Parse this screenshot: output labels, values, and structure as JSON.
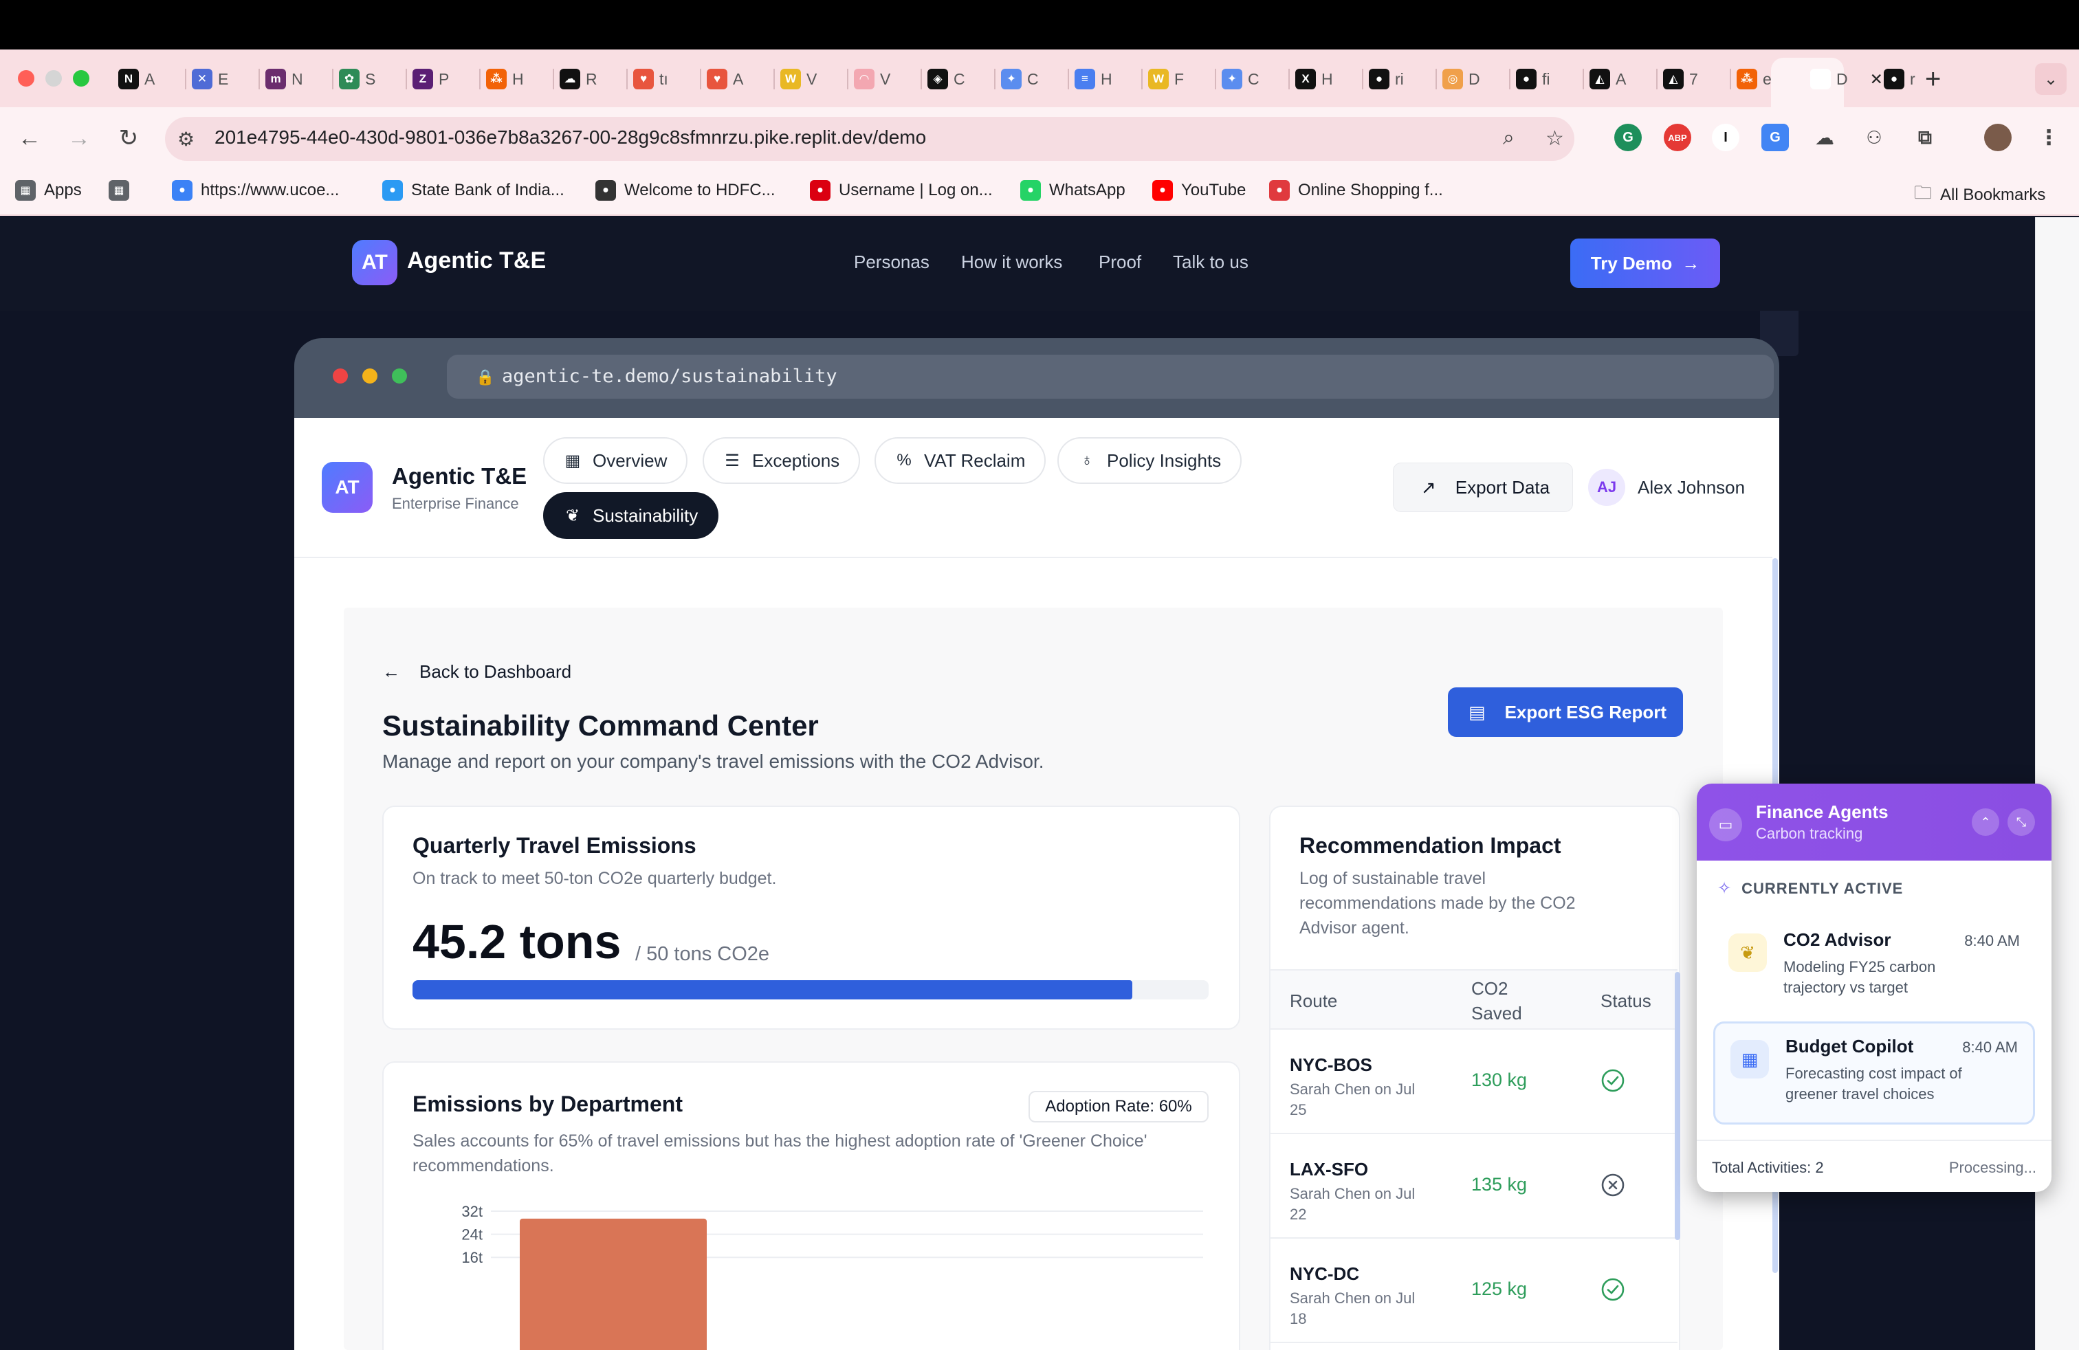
{
  "browser": {
    "tabs": [
      {
        "icon": "notion-icon",
        "label": "A",
        "color": "#111111",
        "glyph": "N"
      },
      {
        "icon": "cross-icon",
        "label": "E",
        "color": "#4f6bd6",
        "glyph": "✕"
      },
      {
        "icon": "m-icon",
        "label": "N",
        "color": "#6b2d6e",
        "glyph": "m"
      },
      {
        "icon": "leaf-icon",
        "label": "S",
        "color": "#2e8b57",
        "glyph": "✿"
      },
      {
        "icon": "z-icon",
        "label": "P",
        "color": "#5b1f74",
        "glyph": "Z"
      },
      {
        "icon": "replit-icon",
        "label": "H",
        "color": "#f26207",
        "glyph": "⁂"
      },
      {
        "icon": "cloud-icon",
        "label": "R",
        "color": "#111111",
        "glyph": "☁"
      },
      {
        "icon": "lovable-icon",
        "label": "tı",
        "color": "#e8553e",
        "glyph": "♥"
      },
      {
        "icon": "lovable-icon",
        "label": "A",
        "color": "#e8553e",
        "glyph": "♥"
      },
      {
        "icon": "w-icon",
        "label": "V",
        "color": "#e9b824",
        "glyph": "W"
      },
      {
        "icon": "rainbow-icon",
        "label": "V",
        "color": "#f3a7b1",
        "glyph": "◠"
      },
      {
        "icon": "cursor-icon",
        "label": "C",
        "color": "#111111",
        "glyph": "◈"
      },
      {
        "icon": "gemini-icon",
        "label": "C",
        "color": "#5b8def",
        "glyph": "✦"
      },
      {
        "icon": "docs-icon",
        "label": "H",
        "color": "#4a7ef0",
        "glyph": "≡"
      },
      {
        "icon": "w-icon",
        "label": "F",
        "color": "#e9b824",
        "glyph": "W"
      },
      {
        "icon": "gemini-icon",
        "label": "C",
        "color": "#5b8def",
        "glyph": "✦"
      },
      {
        "icon": "x-icon",
        "label": "H",
        "color": "#111111",
        "glyph": "X"
      },
      {
        "icon": "github-icon",
        "label": "ri",
        "color": "#111111",
        "glyph": "●"
      },
      {
        "icon": "bolt-icon",
        "label": "D",
        "color": "#f0a04b",
        "glyph": "◎"
      },
      {
        "icon": "github-icon",
        "label": "fi",
        "color": "#111111",
        "glyph": "●"
      },
      {
        "icon": "ai-icon",
        "label": "A",
        "color": "#111111",
        "glyph": "◭"
      },
      {
        "icon": "ai-icon",
        "label": "7",
        "color": "#111111",
        "glyph": "◭"
      },
      {
        "icon": "replit-icon",
        "label": "e",
        "color": "#f26207",
        "glyph": "⁂"
      },
      {
        "icon": "page-icon",
        "label": "D",
        "color": "#ffffff",
        "glyph": ""
      },
      {
        "icon": "github-icon",
        "label": "r",
        "color": "#111111",
        "glyph": "●"
      }
    ],
    "url": "201e4795-44e0-430d-9801-036e7b8a3267-00-28g9c8sfmnrzu.pike.replit.dev/demo",
    "bookmarks": [
      {
        "label": "Apps",
        "icon": "apps-grid-icon",
        "color": "#5f6368"
      },
      {
        "label": "",
        "icon": "tab-groups-icon",
        "color": "#5f6368"
      },
      {
        "label": "https://www.ucoe...",
        "icon": "link-icon",
        "color": "#3b82f6"
      },
      {
        "label": "State Bank of India...",
        "icon": "sbi-icon",
        "color": "#2b9af3"
      },
      {
        "label": "Welcome to HDFC...",
        "icon": "globe-icon",
        "color": "#333333"
      },
      {
        "label": "Username | Log on...",
        "icon": "hsbc-icon",
        "color": "#db0011"
      },
      {
        "label": "WhatsApp",
        "icon": "whatsapp-icon",
        "color": "#25d366"
      },
      {
        "label": "YouTube",
        "icon": "youtube-icon",
        "color": "#ff0000"
      },
      {
        "label": "Online Shopping f...",
        "icon": "shopping-icon",
        "color": "#e03a3e"
      }
    ],
    "all_bookmarks": "All Bookmarks"
  },
  "site": {
    "logo": "AT",
    "brand": "Agentic T&E",
    "nav": [
      "Personas",
      "How it works",
      "Proof",
      "Talk to us"
    ],
    "cta": "Try Demo"
  },
  "mock_browser": {
    "url": "agentic-te.demo/sustainability"
  },
  "app": {
    "logo": "AT",
    "name": "Agentic T&E",
    "subtitle": "Enterprise Finance",
    "tabs": [
      {
        "label": "Overview",
        "icon": "grid-icon",
        "active": false
      },
      {
        "label": "Exceptions",
        "icon": "list-icon",
        "active": false
      },
      {
        "label": "VAT Reclaim",
        "icon": "percent-icon",
        "active": false
      },
      {
        "label": "Policy Insights",
        "icon": "lightbulb-icon",
        "active": false
      },
      {
        "label": "Sustainability",
        "icon": "leaf-icon",
        "active": true
      }
    ],
    "export_data": "Export Data",
    "user_initials": "AJ",
    "user_name": "Alex Johnson"
  },
  "page": {
    "back": "Back to Dashboard",
    "title": "Sustainability Command Center",
    "description": "Manage and report on your company's travel emissions with the CO2 Advisor.",
    "export_esg": "Export ESG Report"
  },
  "emissions": {
    "title": "Quarterly Travel Emissions",
    "description": "On track to meet 50-ton CO2e quarterly budget.",
    "value": "45.2 tons",
    "unit": "/ 50 tons CO2e",
    "progress": 0.904
  },
  "department": {
    "title": "Emissions by Department",
    "badge": "Adoption Rate: 60%",
    "description_line1": "Sales accounts for 65% of travel emissions but has the highest adoption rate of 'Greener Choice'",
    "description_line2": "recommendations."
  },
  "chart_data": {
    "type": "bar",
    "categories": [],
    "values": [
      29.4
    ],
    "bar_color": "#d97556",
    "yticks": [
      "32t",
      "24t",
      "16t"
    ],
    "ylim": [
      0,
      32
    ],
    "grid": true
  },
  "impact": {
    "title": "Recommendation Impact",
    "desc_lines": [
      "Log of sustainable travel",
      "recommendations made by the CO2",
      "Advisor agent."
    ],
    "columns": {
      "route": "Route",
      "saved_line1": "CO2",
      "saved_line2": "Saved",
      "status": "Status"
    },
    "rows": [
      {
        "route": "NYC-BOS",
        "by_line1": "Sarah Chen on Jul",
        "by_line2": "25",
        "saved": "130 kg",
        "status": "accepted"
      },
      {
        "route": "LAX-SFO",
        "by_line1": "Sarah Chen on Jul",
        "by_line2": "22",
        "saved": "135 kg",
        "status": "rejected"
      },
      {
        "route": "NYC-DC",
        "by_line1": "Sarah Chen on Jul",
        "by_line2": "18",
        "saved": "125 kg",
        "status": "accepted"
      }
    ]
  },
  "agents": {
    "title": "Finance Agents",
    "subtitle": "Carbon tracking",
    "section": "CURRENTLY ACTIVE",
    "items": [
      {
        "name": "CO2 Advisor",
        "time": "8:40 AM",
        "desc": "Modeling FY25 carbon trajectory vs target",
        "icon": "leaf-icon",
        "highlight": false
      },
      {
        "name": "Budget Copilot",
        "time": "8:40 AM",
        "desc": "Forecasting cost impact of greener travel choices",
        "icon": "calculator-icon",
        "highlight": true
      }
    ],
    "footer_left": "Total Activities: 2",
    "footer_right": "Processing..."
  }
}
